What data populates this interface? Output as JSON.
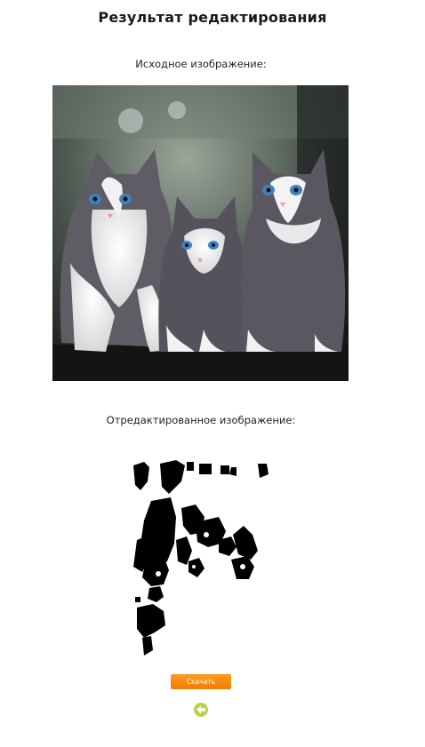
{
  "page": {
    "title": "Результат редактирования"
  },
  "original": {
    "caption": "Исходное изображение:"
  },
  "edited": {
    "caption": "Отредактированное изображение:"
  },
  "actions": {
    "download_label": "Скачать",
    "back_icon": "back-arrow-icon"
  },
  "colors": {
    "accent": "#f08400",
    "back_button": "#b8d24a"
  }
}
